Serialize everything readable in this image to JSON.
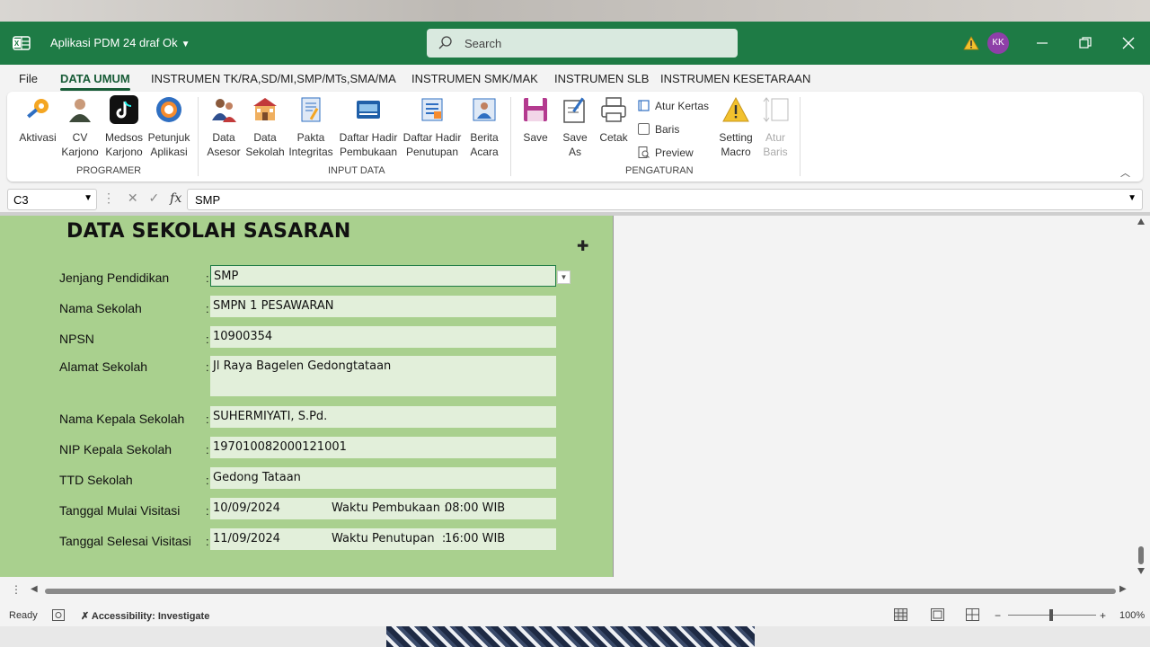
{
  "window": {
    "title": "Aplikasi PDM 24 draf Ok",
    "search_placeholder": "Search",
    "avatar_initials": "KK",
    "accent_color": "#1e7b45"
  },
  "ribbon": {
    "tabs": [
      "File",
      "DATA UMUM",
      "INSTRUMEN TK/RA,SD/MI,SMP/MTs,SMA/MA",
      "INSTRUMEN SMK/MAK",
      "INSTRUMEN SLB",
      "INSTRUMEN KESETARAAN"
    ],
    "active_tab": "DATA UMUM",
    "groups": {
      "programer": {
        "label": "PROGRAMER",
        "buttons": [
          {
            "line1": "Aktivasi",
            "line2": ""
          },
          {
            "line1": "CV",
            "line2": "Karjono"
          },
          {
            "line1": "Medsos",
            "line2": "Karjono"
          },
          {
            "line1": "Petunjuk",
            "line2": "Aplikasi"
          }
        ]
      },
      "input_data": {
        "label": "INPUT DATA",
        "buttons": [
          {
            "line1": "Data",
            "line2": "Asesor"
          },
          {
            "line1": "Data",
            "line2": "Sekolah"
          },
          {
            "line1": "Pakta",
            "line2": "Integritas"
          },
          {
            "line1": "Daftar Hadir",
            "line2": "Pembukaan"
          },
          {
            "line1": "Daftar Hadir",
            "line2": "Penutupan"
          },
          {
            "line1": "Berita",
            "line2": "Acara"
          }
        ]
      },
      "pengaturan": {
        "label": "PENGATURAN",
        "buttons": [
          {
            "line1": "Save",
            "line2": ""
          },
          {
            "line1": "Save",
            "line2": "As"
          },
          {
            "line1": "Cetak",
            "line2": ""
          },
          {
            "line1": "Setting",
            "line2": "Macro"
          },
          {
            "line1": "Atur",
            "line2": "Baris"
          }
        ],
        "small": [
          "Atur Kertas",
          "Baris",
          "Preview"
        ]
      }
    }
  },
  "formula_bar": {
    "cell_ref": "C3",
    "formula": "SMP"
  },
  "form": {
    "title": "DATA SEKOLAH SASARAN",
    "rows": [
      {
        "label": "Jenjang Pendidikan",
        "value": "SMP"
      },
      {
        "label": "Nama Sekolah",
        "value": "SMPN 1 PESAWARAN"
      },
      {
        "label": "NPSN",
        "value": "10900354"
      },
      {
        "label": "Alamat Sekolah",
        "value": "Jl Raya Bagelen Gedongtataan"
      },
      {
        "label": "Nama Kepala Sekolah",
        "value": "SUHERMIYATI, S.Pd."
      },
      {
        "label": "NIP Kepala Sekolah",
        "value": "197010082000121001"
      },
      {
        "label": "TTD Sekolah",
        "value": "Gedong Tataan"
      },
      {
        "label": "Tanggal Mulai Visitasi",
        "value": "10/09/2024",
        "extra_label": "Waktu Pembukaan :",
        "extra_value": "08:00 WIB"
      },
      {
        "label": "Tanggal Selesai Visitasi",
        "value": "11/09/2024",
        "extra_label": "Waktu Penutupan  :",
        "extra_value": "16:00 WIB"
      }
    ]
  },
  "status": {
    "ready": "Ready",
    "accessibility": "Accessibility: Investigate",
    "zoom": "100%"
  }
}
